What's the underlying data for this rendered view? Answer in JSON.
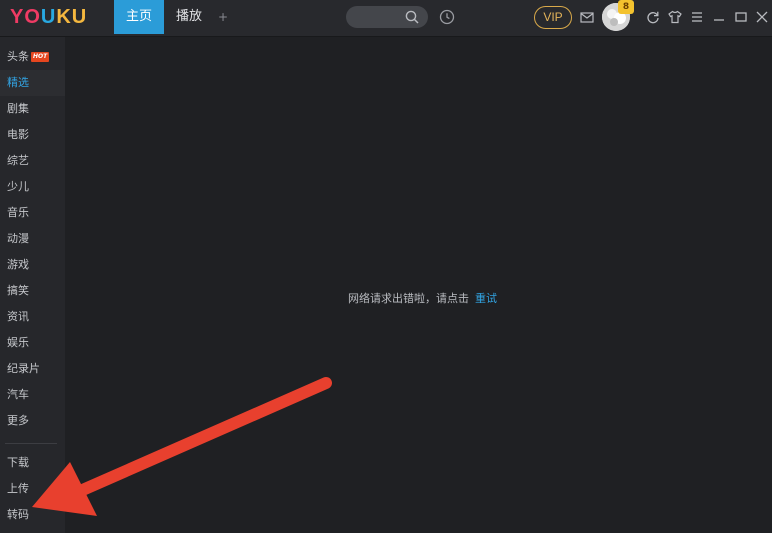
{
  "header": {
    "logo": {
      "part1": "YO",
      "part2": "U",
      "part3": "KU"
    },
    "tabs": [
      {
        "label": "主页",
        "active": true
      },
      {
        "label": "播放",
        "active": false
      }
    ],
    "add_tab": "+",
    "search": {
      "placeholder": ""
    },
    "vip_label": "VIP",
    "avatar_level": "8",
    "accent_color": "#2b9cd8"
  },
  "sidebar": {
    "items": [
      {
        "label": "头条",
        "badge": "HOT"
      },
      {
        "label": "精选",
        "active": true
      },
      {
        "label": "剧集"
      },
      {
        "label": "电影"
      },
      {
        "label": "综艺"
      },
      {
        "label": "少儿"
      },
      {
        "label": "音乐"
      },
      {
        "label": "动漫"
      },
      {
        "label": "游戏"
      },
      {
        "label": "搞笑"
      },
      {
        "label": "资讯"
      },
      {
        "label": "娱乐"
      },
      {
        "label": "纪录片"
      },
      {
        "label": "汽车"
      },
      {
        "label": "更多"
      }
    ],
    "tools": [
      {
        "label": "下载"
      },
      {
        "label": "上传"
      },
      {
        "label": "转码"
      }
    ]
  },
  "main": {
    "error_text": "网络请求出错啦，请点击",
    "retry_label": "重试"
  },
  "annotation": {
    "arrow_color": "#e8402e"
  }
}
